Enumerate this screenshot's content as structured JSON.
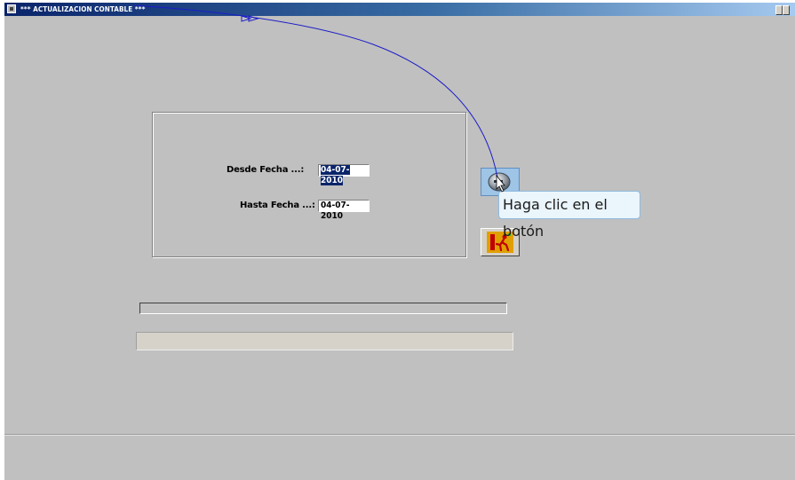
{
  "window": {
    "title": "*** ACTUALIZACION CONTABLE ***"
  },
  "form": {
    "desde_label": "Desde Fecha ...:",
    "desde_value": "04-07-2010",
    "hasta_label": "Hasta Fecha ...:",
    "hasta_value": "04-07-2010"
  },
  "buttons": {
    "process_icon": "disk-process-icon",
    "exit_icon": "exit-running-man-icon"
  },
  "tooltip": {
    "text": "Haga clic en el botón"
  },
  "annotation": {
    "arrow_color": "#1c1cc8"
  },
  "colors": {
    "title_bar_start": "#0a246a",
    "title_bar_end": "#a6caf0",
    "window_bg": "#c0c0c0",
    "selection": "#0a246a"
  }
}
